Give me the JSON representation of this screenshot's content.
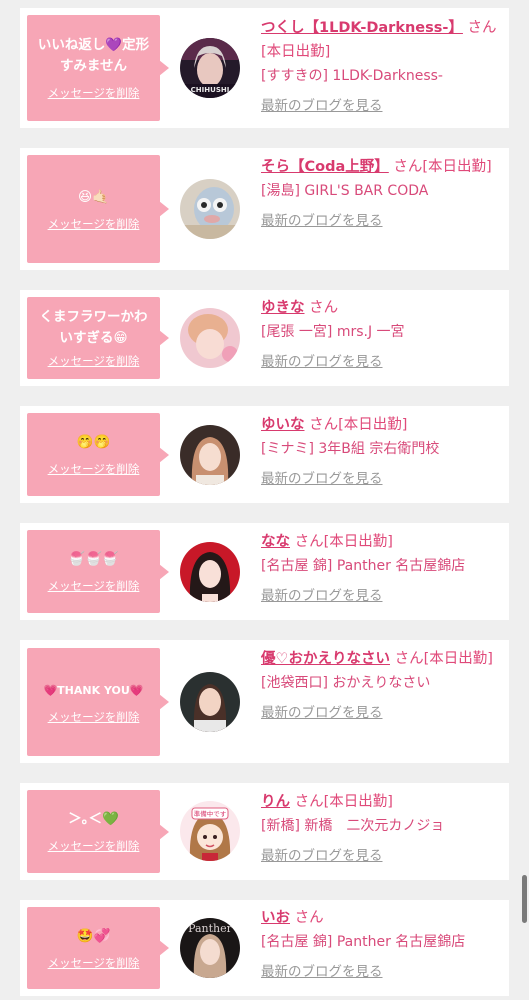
{
  "delete_label": "メッセージを削除",
  "blog_label": "最新のブログを見る",
  "entries": [
    {
      "message": "いいね返し💜定形すみません",
      "name": "つくし【1LDK-Darkness-】",
      "suffix": " さん[本日出勤]",
      "shop": "[すすきの] 1LDK-Darkness-",
      "avatar_text": "CHIHUSHI"
    },
    {
      "message": "😆🤙🏻",
      "name": "そら【Coda上野】",
      "suffix": " さん[本日出勤]",
      "shop": "[湯島] GIRL'S BAR CODA",
      "avatar_text": ""
    },
    {
      "message": "くまフラワーかわいすぎる😁",
      "name": "ゆきな",
      "suffix": " さん",
      "shop": "[尾張 一宮] mrs.J 一宮",
      "avatar_text": ""
    },
    {
      "message": "🤭🤭",
      "name": "ゆいな",
      "suffix": " さん[本日出勤]",
      "shop": "[ミナミ] 3年B組 宗右衛門校",
      "avatar_text": ""
    },
    {
      "message": "🍧🍧🍧",
      "name": "なな",
      "suffix": " さん[本日出勤]",
      "shop": "[名古屋 錦] Panther 名古屋錦店",
      "avatar_text": ""
    },
    {
      "message": "💗THANK YOU💗",
      "name": "優♡おかえりなさい",
      "suffix": " さん[本日出勤]",
      "shop": "[池袋西口] おかえりなさい",
      "avatar_text": ""
    },
    {
      "message": "＞｡＜💚",
      "name": "りん",
      "suffix": " さん[本日出勤]",
      "shop": "[新橋] 新橋　二次元カノジョ",
      "avatar_text": "準備中です"
    },
    {
      "message": "🤩💞",
      "name": "いお",
      "suffix": " さん",
      "shop": "[名古屋 錦] Panther 名古屋錦店",
      "avatar_text": "Panther"
    }
  ]
}
